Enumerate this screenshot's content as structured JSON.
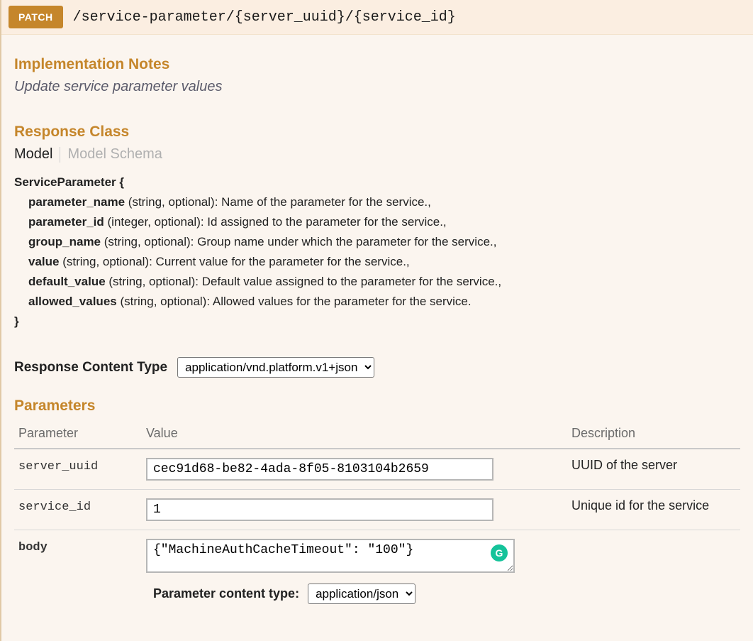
{
  "header": {
    "method": "PATCH",
    "path": "/service-parameter/{server_uuid}/{service_id}"
  },
  "implementationNotes": {
    "title": "Implementation Notes",
    "text": "Update service parameter values"
  },
  "responseClass": {
    "title": "Response Class",
    "tabModel": "Model",
    "tabModelSchema": "Model Schema",
    "structName": "ServiceParameter {",
    "structClose": "}",
    "props": [
      {
        "name": "parameter_name",
        "rest": " (string, optional): Name of the parameter for the service.,"
      },
      {
        "name": "parameter_id",
        "rest": " (integer, optional): Id assigned to the parameter for the service.,"
      },
      {
        "name": "group_name",
        "rest": " (string, optional): Group name under which the parameter for the service.,"
      },
      {
        "name": "value",
        "rest": " (string, optional): Current value for the parameter for the service.,"
      },
      {
        "name": "default_value",
        "rest": " (string, optional): Default value assigned to the parameter for the service.,"
      },
      {
        "name": "allowed_values",
        "rest": " (string, optional): Allowed values for the parameter for the service."
      }
    ]
  },
  "responseContentType": {
    "label": "Response Content Type",
    "selected": "application/vnd.platform.v1+json"
  },
  "parameters": {
    "title": "Parameters",
    "headers": {
      "param": "Parameter",
      "value": "Value",
      "desc": "Description"
    },
    "rows": [
      {
        "name": "server_uuid",
        "value": "cec91d68-be82-4ada-8f05-8103104b2659",
        "desc": "UUID of the server",
        "type": "text"
      },
      {
        "name": "service_id",
        "value": "1",
        "desc": "Unique id for the service",
        "type": "text"
      },
      {
        "name": "body",
        "value": "{\"MachineAuthCacheTimeout\": \"100\"}",
        "desc": "",
        "type": "body"
      }
    ],
    "paramContentType": {
      "label": "Parameter content type:",
      "selected": "application/json"
    }
  },
  "grammarlyGlyph": "G"
}
